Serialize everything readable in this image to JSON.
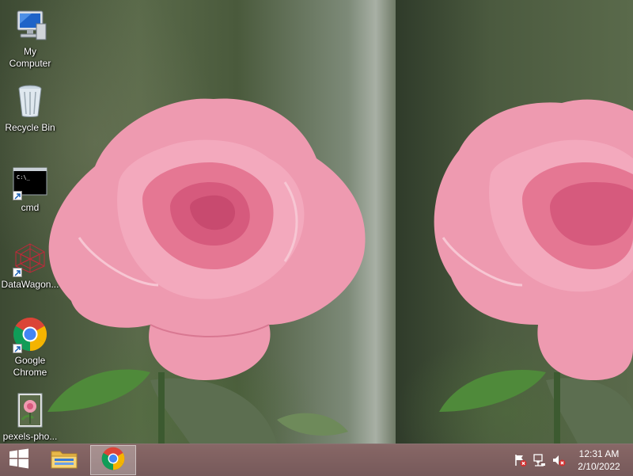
{
  "desktop": {
    "icons": [
      {
        "label": "My\nComputer",
        "icon": "computer-icon"
      },
      {
        "label": "Recycle Bin",
        "icon": "recycle-bin-icon"
      },
      {
        "label": "cmd",
        "icon": "cmd-icon"
      },
      {
        "label": "DataWagon...",
        "icon": "datawagon-icon"
      },
      {
        "label": "Google\nChrome",
        "icon": "chrome-icon"
      },
      {
        "label": "pexels-pho...",
        "icon": "image-file-icon"
      }
    ]
  },
  "taskbar": {
    "start_icon": "windows-logo-icon",
    "pinned": [
      {
        "name": "File Explorer",
        "icon": "folder-icon",
        "active": false
      },
      {
        "name": "Google Chrome",
        "icon": "chrome-icon",
        "active": true
      }
    ],
    "tray": {
      "icons": [
        "action-center-flag-icon",
        "network-icon",
        "volume-muted-icon"
      ],
      "time": "12:31 AM",
      "date": "2/10/2022"
    }
  },
  "colors": {
    "rose": "#e98aa3",
    "taskbar": "#8c6969",
    "foliage": "#4a5a3c"
  }
}
